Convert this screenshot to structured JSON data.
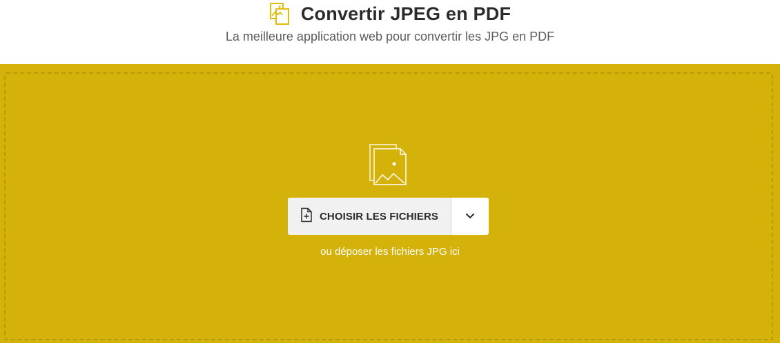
{
  "header": {
    "title": "Convertir JPEG en PDF",
    "subtitle": "La meilleure application web pour convertir les JPG en PDF",
    "icon": "image-file-icon"
  },
  "dropzone": {
    "icon": "image-files-icon",
    "choose_label": "CHOISIR LES FICHIERS",
    "choose_icon": "add-file-icon",
    "dropdown_icon": "chevron-down-icon",
    "drop_hint": "ou déposer les fichiers JPG ici"
  },
  "colors": {
    "accent": "#d4b209",
    "title_icon": "#e2bd0c",
    "button_bg": "#f1f1f1",
    "text_dark": "#2b2b2b"
  }
}
